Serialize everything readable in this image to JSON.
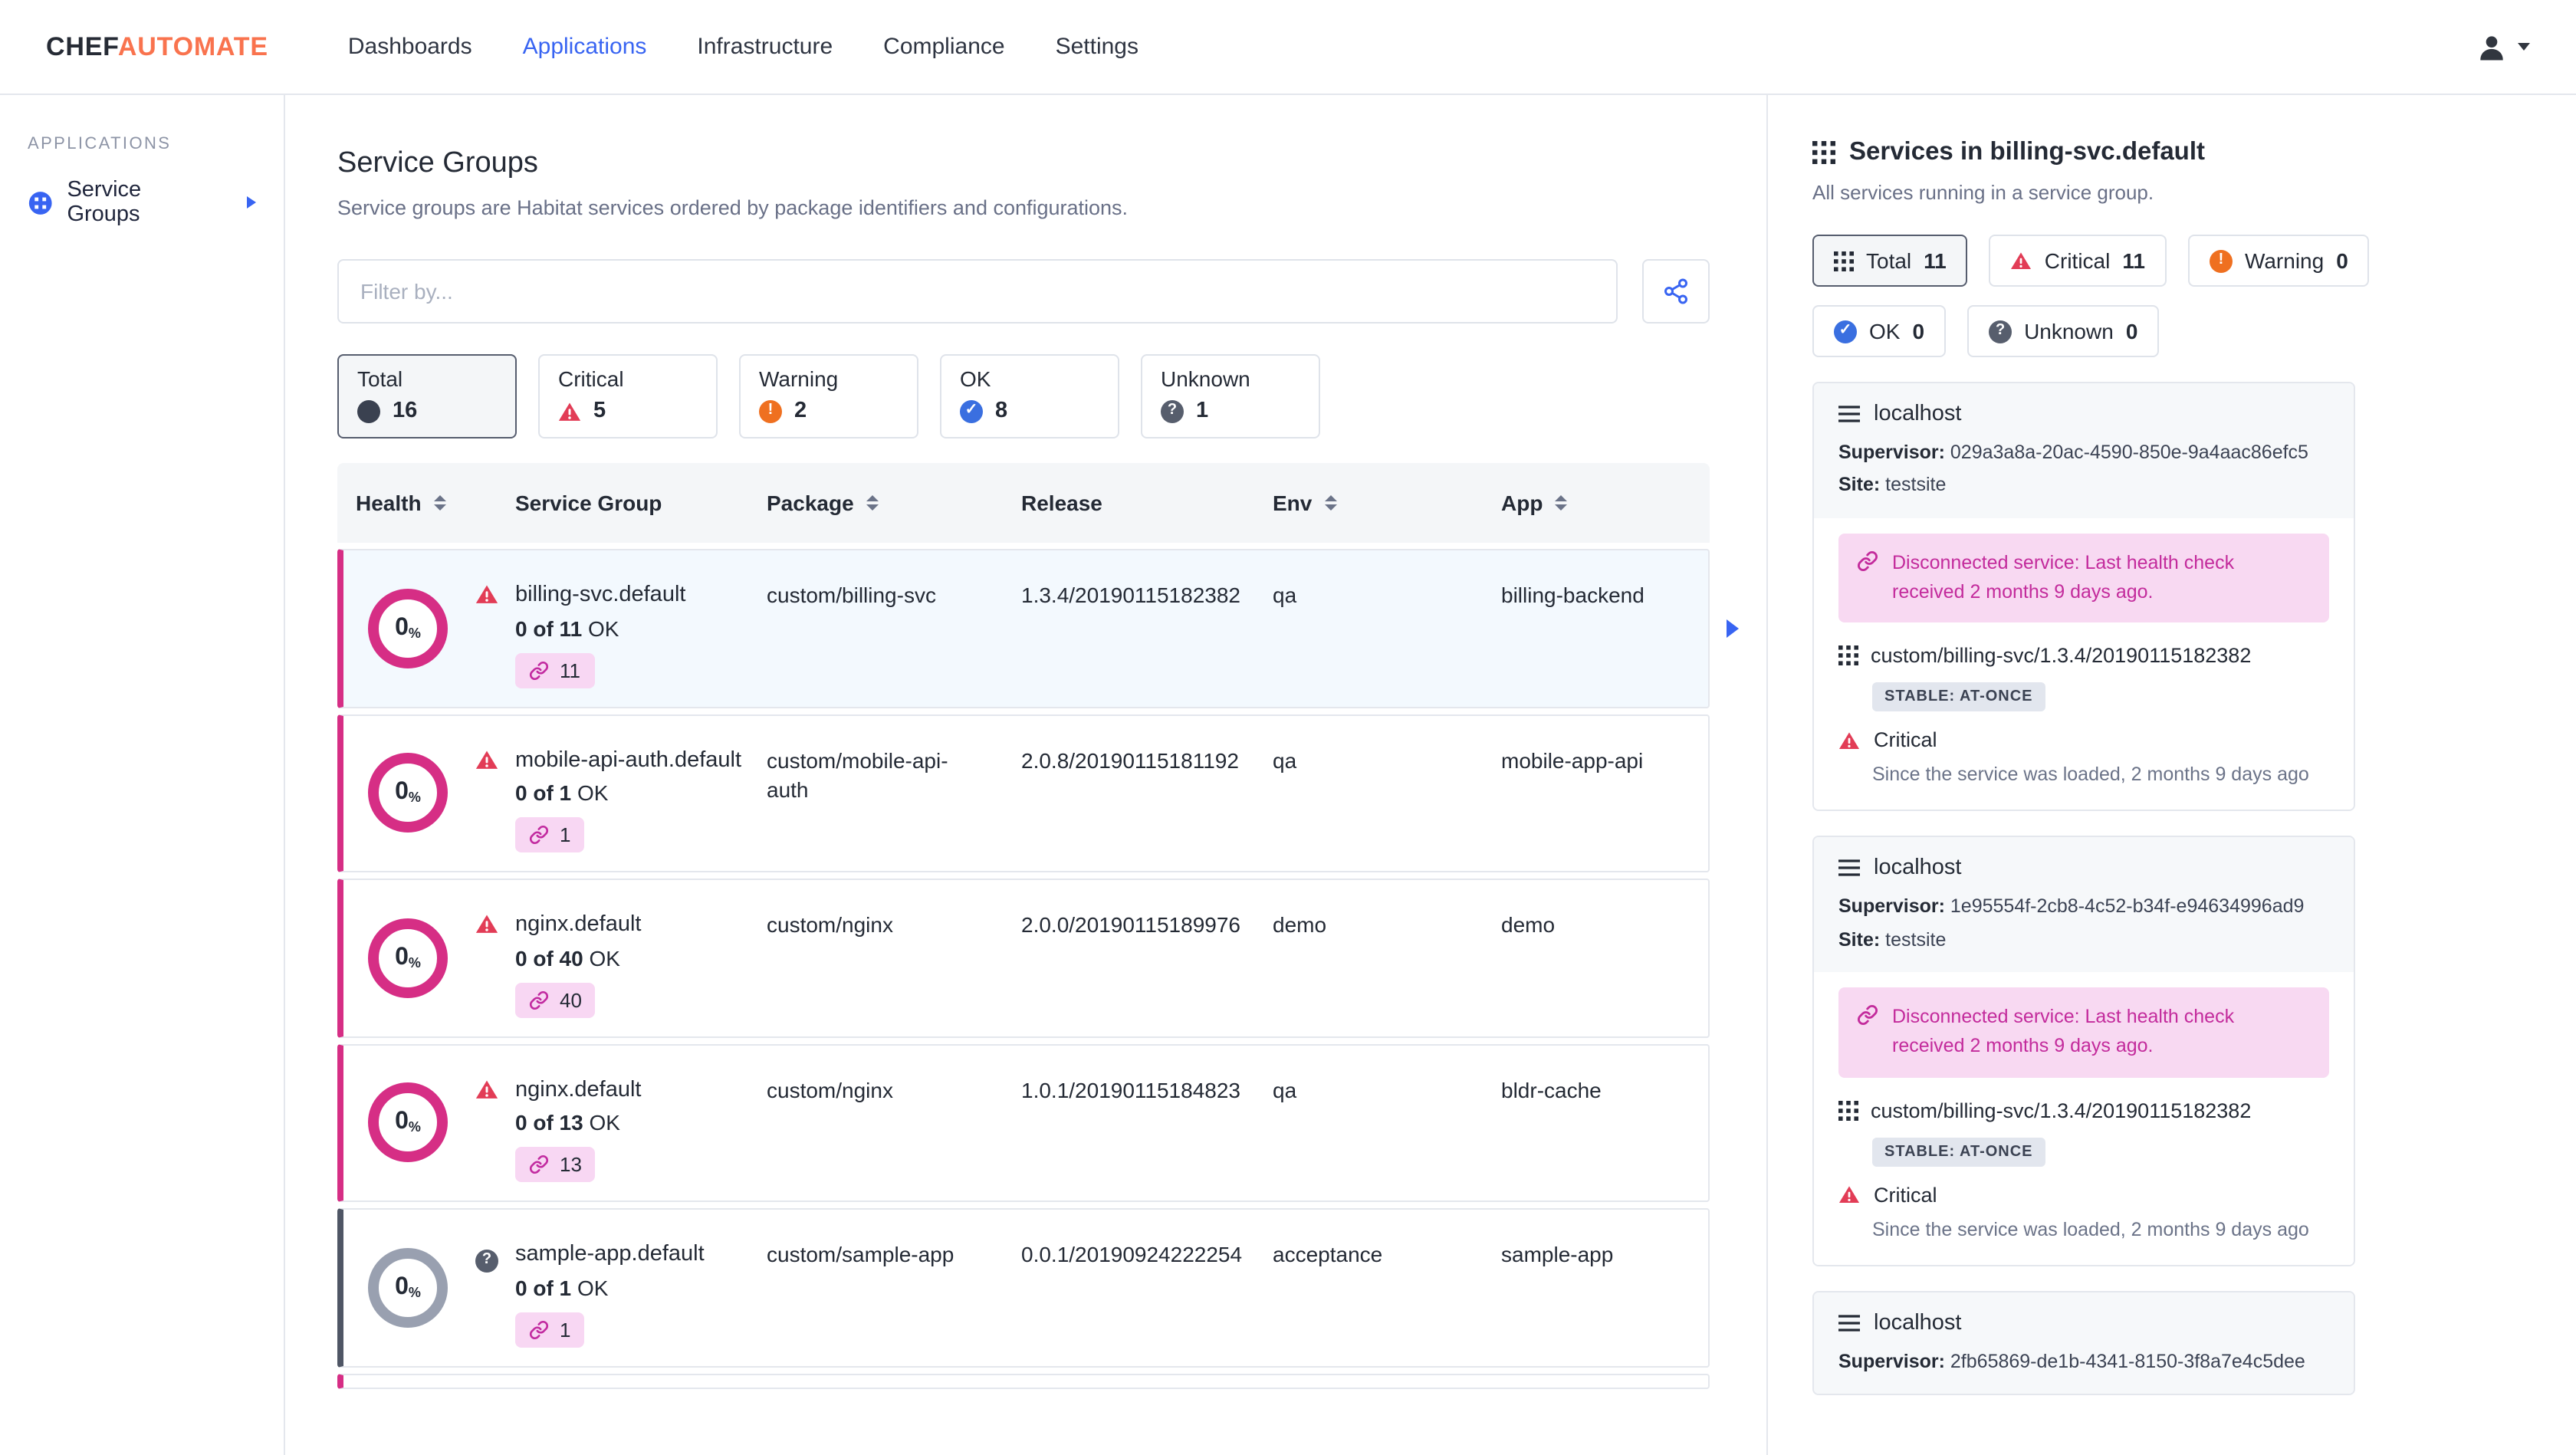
{
  "navbar": {
    "logo_chef": "CHEF",
    "logo_automate": "AUTOMATE",
    "items": [
      {
        "label": "Dashboards",
        "active": false
      },
      {
        "label": "Applications",
        "active": true
      },
      {
        "label": "Infrastructure",
        "active": false
      },
      {
        "label": "Compliance",
        "active": false
      },
      {
        "label": "Settings",
        "active": false
      }
    ]
  },
  "sidebar": {
    "section_label": "APPLICATIONS",
    "items": [
      {
        "label": "Service Groups"
      }
    ]
  },
  "main": {
    "title": "Service Groups",
    "subtitle": "Service groups are Habitat services ordered by package identifiers and configurations.",
    "filter": {
      "placeholder": "Filter by..."
    },
    "status_cards": [
      {
        "label": "Total",
        "count": "16",
        "status": "total",
        "selected": true
      },
      {
        "label": "Critical",
        "count": "5",
        "status": "critical",
        "selected": false
      },
      {
        "label": "Warning",
        "count": "2",
        "status": "warning",
        "selected": false
      },
      {
        "label": "OK",
        "count": "8",
        "status": "ok",
        "selected": false
      },
      {
        "label": "Unknown",
        "count": "1",
        "status": "unknown",
        "selected": false
      }
    ],
    "table": {
      "percent_sign": "%",
      "headers": {
        "health": "Health",
        "service_group": "Service Group",
        "package": "Package",
        "release": "Release",
        "env": "Env",
        "app": "App"
      },
      "rows": [
        {
          "health_percent": "0",
          "status": "critical",
          "selected": true,
          "name": "billing-svc.default",
          "ok_count": "0 of 11",
          "ok_label": "OK",
          "services_count": "11",
          "package": "custom/billing-svc",
          "release": "1.3.4/20190115182382",
          "env": "qa",
          "app": "billing-backend"
        },
        {
          "health_percent": "0",
          "status": "critical",
          "selected": false,
          "name": "mobile-api-auth.default",
          "ok_count": "0 of 1",
          "ok_label": "OK",
          "services_count": "1",
          "package": "custom/mobile-api-auth",
          "release": "2.0.8/20190115181192",
          "env": "qa",
          "app": "mobile-app-api"
        },
        {
          "health_percent": "0",
          "status": "critical",
          "selected": false,
          "name": "nginx.default",
          "ok_count": "0 of 40",
          "ok_label": "OK",
          "services_count": "40",
          "package": "custom/nginx",
          "release": "2.0.0/20190115189976",
          "env": "demo",
          "app": "demo"
        },
        {
          "health_percent": "0",
          "status": "critical",
          "selected": false,
          "name": "nginx.default",
          "ok_count": "0 of 13",
          "ok_label": "OK",
          "services_count": "13",
          "package": "custom/nginx",
          "release": "1.0.1/20190115184823",
          "env": "qa",
          "app": "bldr-cache"
        },
        {
          "health_percent": "0",
          "status": "unknown",
          "selected": false,
          "name": "sample-app.default",
          "ok_count": "0 of 1",
          "ok_label": "OK",
          "services_count": "1",
          "package": "custom/sample-app",
          "release": "0.0.1/20190924222254",
          "env": "acceptance",
          "app": "sample-app"
        }
      ]
    }
  },
  "panel": {
    "title": "Services in billing-svc.default",
    "subtitle": "All services running in a service group.",
    "pills": [
      {
        "label": "Total",
        "count": "11",
        "status": "total",
        "selected": true
      },
      {
        "label": "Critical",
        "count": "11",
        "status": "critical",
        "selected": false
      },
      {
        "label": "Warning",
        "count": "0",
        "status": "warning",
        "selected": false
      },
      {
        "label": "OK",
        "count": "0",
        "status": "ok",
        "selected": false
      },
      {
        "label": "Unknown",
        "count": "0",
        "status": "unknown",
        "selected": false
      }
    ],
    "cards": [
      {
        "host": "localhost",
        "supervisor_label": "Supervisor:",
        "supervisor": "029a3a8a-20ac-4590-850e-9a4aac86efc5",
        "site_label": "Site:",
        "site": "testsite",
        "alert": "Disconnected service: Last health check received 2 months 9 days ago.",
        "package": "custom/billing-svc/1.3.4/20190115182382",
        "badge": "STABLE: AT-ONCE",
        "health": "Critical",
        "since": "Since the service was loaded, 2 months 9 days ago"
      },
      {
        "host": "localhost",
        "supervisor_label": "Supervisor:",
        "supervisor": "1e95554f-2cb8-4c52-b34f-e94634996ad9",
        "site_label": "Site:",
        "site": "testsite",
        "alert": "Disconnected service: Last health check received 2 months 9 days ago.",
        "package": "custom/billing-svc/1.3.4/20190115182382",
        "badge": "STABLE: AT-ONCE",
        "health": "Critical",
        "since": "Since the service was loaded, 2 months 9 days ago"
      },
      {
        "host": "localhost",
        "supervisor_label": "Supervisor:",
        "supervisor": "2fb65869-de1b-4341-8150-3f8a7e4c5dee"
      }
    ]
  }
}
